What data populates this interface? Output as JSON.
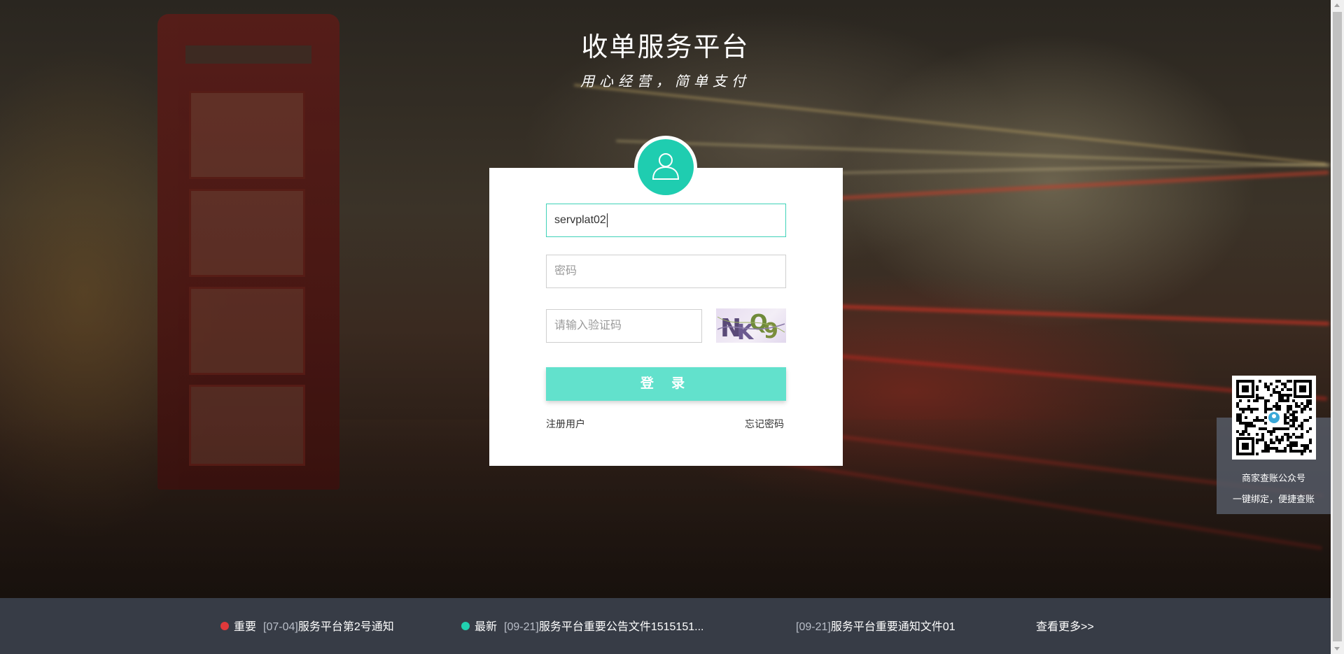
{
  "header": {
    "title": "收单服务平台",
    "slogan": "用心经营，简单支付"
  },
  "login": {
    "username_value": "servplat02",
    "password_placeholder": "密码",
    "captcha_placeholder": "请输入验证码",
    "captcha_text": "NKQ9",
    "login_button": "登 录",
    "register_link": "注册用户",
    "forgot_link": "忘记密码"
  },
  "qr": {
    "line1": "商家查账公众号",
    "line2": "一键绑定，便捷查账"
  },
  "notices": [
    {
      "tag": "重要",
      "date": "[07-04]",
      "title": "服务平台第2号通知",
      "dot_color": "#e0393b"
    },
    {
      "tag": "最新",
      "date": "[09-21]",
      "title": "服务平台重要公告文件1515151...",
      "dot_color": "#21d0b0"
    },
    {
      "tag": "",
      "date": "[09-21]",
      "title": "服务平台重要通知文件01",
      "dot_color": ""
    }
  ],
  "more_link": "查看更多>>",
  "colors": {
    "accent": "#1fcdb0",
    "button": "#62e1cc",
    "notice_bar": "#373c46"
  },
  "icons": [
    "user-icon",
    "qr-code-icon"
  ]
}
